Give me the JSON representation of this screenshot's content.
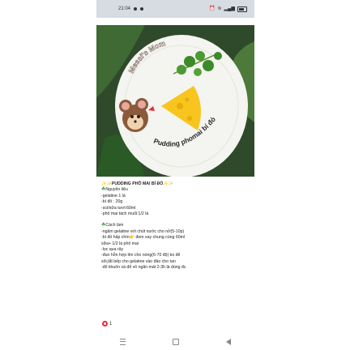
{
  "status_bar": {
    "time": "21:04",
    "icons": [
      "notification-dot-icon",
      "notification-dot-icon",
      "alarm-icon",
      "wifi-icon",
      "signal-icon",
      "battery-icon"
    ]
  },
  "photo": {
    "watermark_top": "Messi's Mom",
    "caption": "Pudding phomai bí đỏ",
    "colors": {
      "background": "#2f4a2a",
      "plate": "#f4f4f0",
      "pudding": "#f7c51e",
      "herb": "#3d8a2a"
    }
  },
  "post": {
    "title": "PUDDING PHÔ MAI BÍ ĐỎ",
    "ingredients_heading": "Nguyên liệu",
    "ingredients": [
      "-gelatine 1 lá",
      "-bí đỏ : 20g",
      "-sct/sữa tươi:60ml",
      "-phô mai tách muối:1/2 lá"
    ],
    "method_heading": "Cách làm",
    "steps": [
      "-ngâm gelatine với chút nước cho nở(5-10p)",
      "-bí đỏ hấp chín👉 đem xay chung cùng 60ml",
      "sữa+ 1/2 lá phô mai",
      "-lọc qua rây",
      "-đun hỗn hợp lên cho nóng(6-70 độ) ko để",
      "sôi,tắt bếp cho gelatine vào đảo cho tan",
      "-đổ khuôn và để vô ngăn mát 2-3h là dùng đc."
    ],
    "reactions": {
      "count": "1"
    }
  },
  "nav": {
    "icons": [
      "menu-icon",
      "home-icon",
      "back-icon"
    ]
  }
}
